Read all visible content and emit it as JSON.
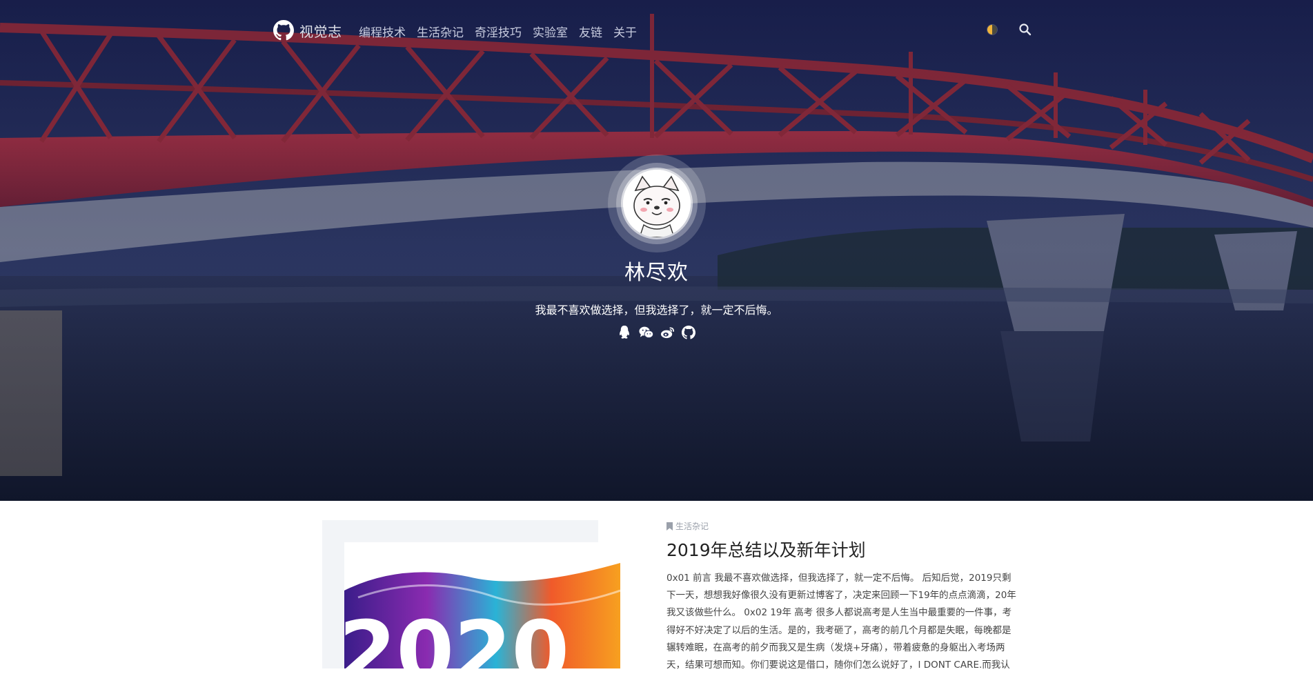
{
  "nav": {
    "brand": "视觉志",
    "menu": [
      {
        "label": "编程技术"
      },
      {
        "label": "生活杂记"
      },
      {
        "label": "奇淫技巧"
      },
      {
        "label": "实验室"
      },
      {
        "label": "友链"
      },
      {
        "label": "关于"
      }
    ],
    "icons": {
      "brand": "github-icon",
      "theme": "theme-toggle-icon",
      "search": "search-icon"
    }
  },
  "profile": {
    "name": "林尽欢",
    "motto": "我最不喜欢做选择，但我选择了，就一定不后悔。",
    "socials": [
      "qq-icon",
      "wechat-icon",
      "weibo-icon",
      "github-icon"
    ]
  },
  "post": {
    "category": "生活杂记",
    "title": "2019年总结以及新年计划",
    "cover_text": "2020",
    "excerpt_lines": [
      "0x01 前言 我最不喜欢做选择，但我选择了，就一定不后悔。 后知后觉，2019只剩",
      "下一天，想想我好像很久没有更新过博客了，决定来回顾一下19年的点点滴滴，20年",
      "我又该做些什么。 0x02 19年 高考 很多人都说高考是人生当中最重要的一件事，考",
      "得好不好决定了以后的生活。是的，我考砸了，高考的前几个月都是失眠，每晚都是",
      "辗转难眠，在高考的前夕而我又是生病（发烧+牙痛），带着疲惫的身躯出入考场两",
      "天，结果可想而知。你们要说这是借口，随你们怎么说好了，I DONT CARE.而我认"
    ]
  },
  "colors": {
    "hero_bg": "#1c2347",
    "bridge": "#8e2a3a",
    "text_light": "#ffffff",
    "theme_toggle": "#f1b53c"
  }
}
